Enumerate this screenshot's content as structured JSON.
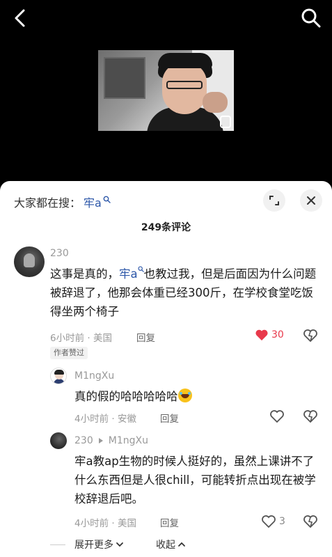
{
  "search": {
    "prefix": "大家都在搜：",
    "keyword": "牢a"
  },
  "comments_header": {
    "count_label": "249条评论"
  },
  "comments": [
    {
      "username": "230",
      "text_part1": "这事是真的，",
      "mention": "牢a",
      "text_part2": "也教过我，但是后面因为什么问题被辞退了，他那会体重已经300斤，在学校食堂吃饭得坐两个椅子",
      "meta": "6小时前 · 美国",
      "reply_label": "回复",
      "likes": "30",
      "author_tag": "作者赞过"
    },
    {
      "username": "M1ngXu",
      "text": "真的假的哈哈哈哈哈",
      "meta": "4小时前 · 安徽",
      "reply_label": "回复"
    },
    {
      "username": "230",
      "reply_to": "M1ngXu",
      "text": "牢a教ap生物的时候人挺好的，虽然上课讲不了什么东西但是人很chill，可能转折点出现在被学校辞退后吧。",
      "meta": "4小时前 · 美国",
      "reply_label": "回复",
      "likes": "3"
    }
  ],
  "footer": {
    "expand_more": "展开更多",
    "collapse": "收起"
  },
  "colors": {
    "accent_link": "#2b56a8",
    "like_red": "#e8394b"
  }
}
